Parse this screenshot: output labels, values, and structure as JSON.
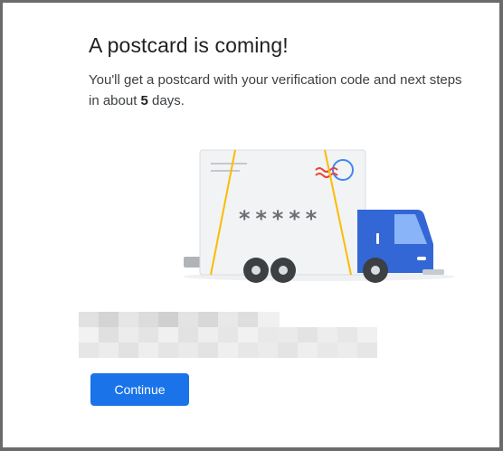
{
  "dialog": {
    "title": "A postcard is coming!",
    "description_before": "You'll get a postcard with your verification code and next steps in about ",
    "description_days": "5",
    "description_after": " days.",
    "illustration": {
      "code_mask": "*****",
      "icon": "postcard-delivery-truck-illustration"
    },
    "redacted_text_lines": 2,
    "continue_label": "Continue"
  },
  "colors": {
    "accent": "#1a73e8",
    "truck_blue": "#3367d6",
    "string_yellow": "#fbbc04",
    "stamp_red": "#ea4335"
  }
}
